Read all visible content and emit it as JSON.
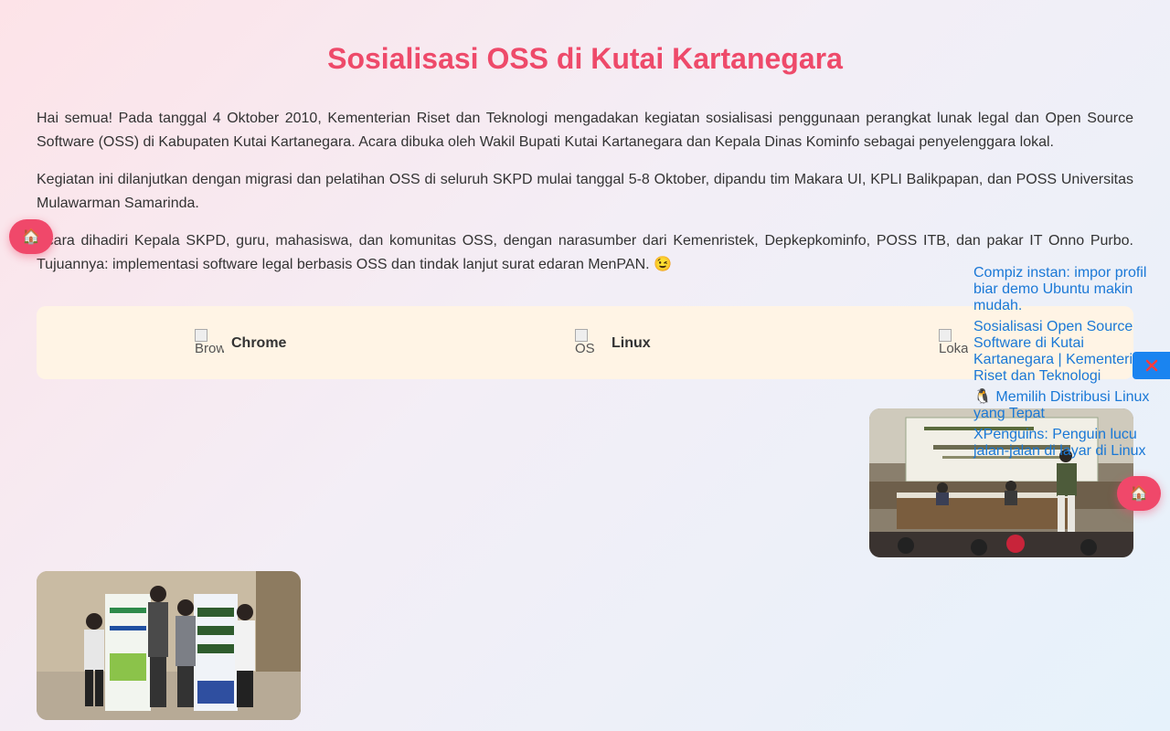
{
  "article": {
    "title": "Sosialisasi OSS di Kutai Kartanegara",
    "paragraphs": [
      "Hai semua! Pada tanggal 4 Oktober 2010, Kementerian Riset dan Teknologi mengadakan kegiatan sosialisasi penggunaan perangkat lunak legal dan Open Source Software (OSS) di Kabupaten Kutai Kartanegara. Acara dibuka oleh Wakil Bupati Kutai Kartanegara dan Kepala Dinas Kominfo sebagai penyelenggara lokal.",
      "Kegiatan ini dilanjutkan dengan migrasi dan pelatihan OSS di seluruh SKPD mulai tanggal 5-8 Oktober, dipandu tim Makara UI, KPLI Balikpapan, dan POSS Universitas Mulawarman Samarinda.",
      "Acara dihadiri Kepala SKPD, guru, mahasiswa, dan komunitas OSS, dengan narasumber dari Kemenristek, Depkepkominfo, POSS ITB, dan pakar IT Onno Purbo. Tujuannya: implementasi software legal berbasis OSS dan tindak lanjut surat edaran MenPAN. 😉"
    ]
  },
  "info_bar": {
    "items": [
      {
        "alt": "Browser",
        "label": "Chrome"
      },
      {
        "alt": "OS",
        "label": "Linux"
      },
      {
        "alt": "Lokasi",
        "label": ""
      }
    ]
  },
  "fab": {
    "home_glyph": "🏠"
  },
  "side_links": [
    "Compiz instan: impor profil biar demo Ubuntu makin mudah.",
    "Sosialisasi Open Source Software di Kutai Kartanegara | Kementerian Riset dan Teknologi",
    "🐧 Memilih Distribusi Linux yang Tepat",
    "XPenguins: Penguin lucu jalan-jalan di layar di Linux"
  ],
  "colors": {
    "title": "#ee4a6a",
    "link": "#1a78d6",
    "fab": "#f0486a",
    "close": "#1a84f0",
    "info_bar_bg": "#fff4e5"
  },
  "icons": {
    "close": "close-x-icon",
    "home": "home-icon"
  }
}
